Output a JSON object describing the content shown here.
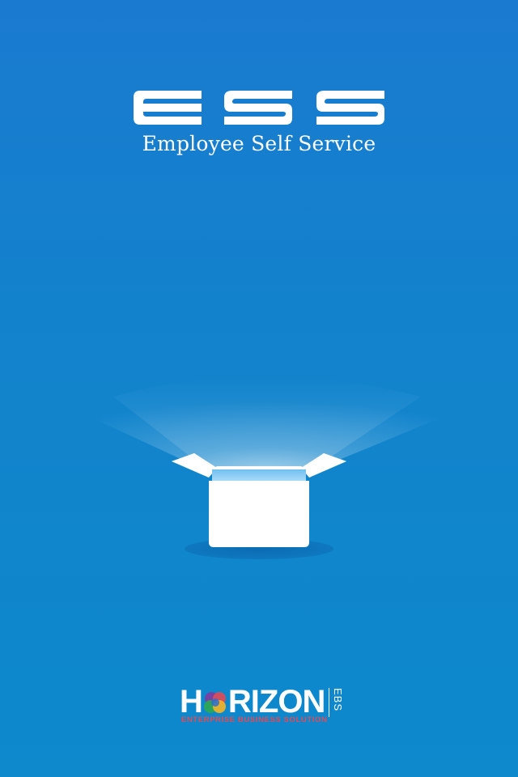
{
  "splash": {
    "logo_text": "ESS",
    "subtitle": "Employee Self Service",
    "illustration": "open-box-light-icon"
  },
  "footer": {
    "brand_prefix": "H",
    "brand_suffix": "RIZON",
    "brand_side": "EBS",
    "tagline": "ENTERPRISE BUSINESS SOLUTION"
  },
  "colors": {
    "background_top": "#1a7ad0",
    "background_bottom": "#0d89cc",
    "text": "#ffffff",
    "tagline": "#e24a55"
  }
}
